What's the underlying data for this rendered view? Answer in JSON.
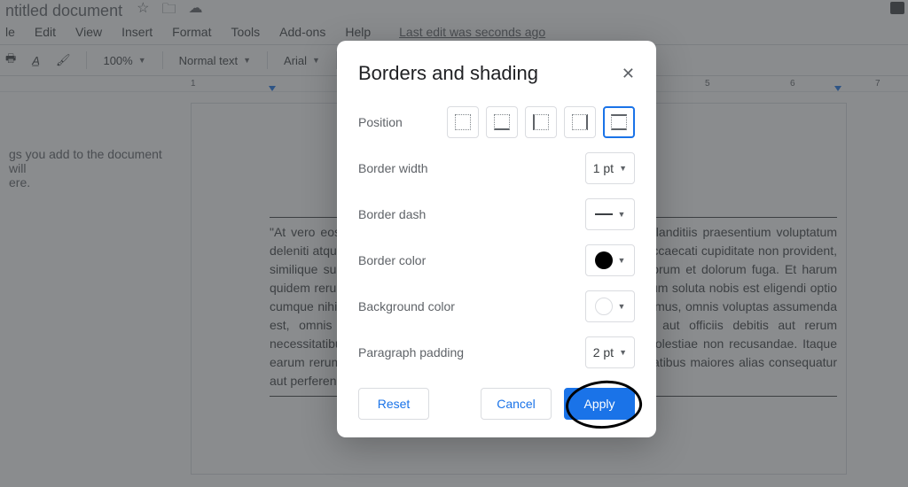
{
  "titlebar": {
    "doc_title": "ntitled document"
  },
  "menubar": {
    "items": [
      "le",
      "Edit",
      "View",
      "Insert",
      "Format",
      "Tools",
      "Add-ons",
      "Help"
    ],
    "last_edit": "Last edit was seconds ago"
  },
  "toolbar": {
    "zoom": "100%",
    "style": "Normal text",
    "font": "Arial"
  },
  "ruler": {
    "marks": [
      "1",
      "5",
      "6",
      "7"
    ]
  },
  "outline": {
    "hint": "gs you add to the document will\nere."
  },
  "document": {
    "paragraph": "\"At vero eos et accusamus et iusto odio dignissimos ducimus qui blanditiis praesentium voluptatum deleniti atque corrupti quos dolores et quas molestias excepturi sint occaecati cupiditate non provident, similique sunt in culpa qui officia deserunt mollitia animi, id est laborum et dolorum fuga. Et harum quidem rerum facilis est et expedita distinctio. Nam libero tempore, cum soluta nobis est eligendi optio cumque nihil impedit quo minus id quod maxime placeat facere possimus, omnis voluptas assumenda est, omnis dolor repellendus. Temporibus autem quibusdam et aut officiis debitis aut rerum necessitatibus saepe eveniet ut et voluptates repudiandae sint et molestiae non recusandae. Itaque earum rerum hic tenetur a sapiente delectus, ut aut reiciendis voluptatibus maiores alias consequatur aut perferendis doloribus asperiores repellat.\""
  },
  "dialog": {
    "title": "Borders and shading",
    "labels": {
      "position": "Position",
      "width": "Border width",
      "dash": "Border dash",
      "color": "Border color",
      "bg": "Background color",
      "padding": "Paragraph padding"
    },
    "values": {
      "width": "1 pt",
      "padding": "2 pt"
    },
    "actions": {
      "reset": "Reset",
      "cancel": "Cancel",
      "apply": "Apply"
    }
  }
}
